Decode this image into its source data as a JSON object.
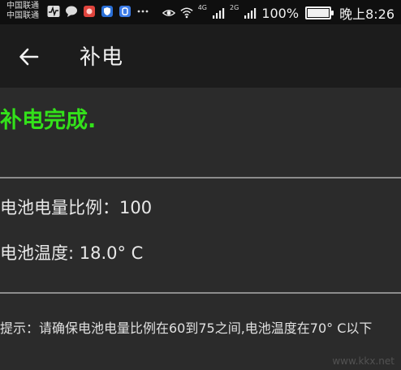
{
  "status_bar": {
    "carrier_1": "中国联通",
    "carrier_2": "中国联通",
    "signal_1_label": "4G",
    "signal_2_label": "2G",
    "battery_percent_text": "100%",
    "battery_level": 1.0,
    "time": "晚上8:26",
    "notification_icons": [
      "pulse-icon",
      "chat-icon",
      "app-icon",
      "shield-icon",
      "vpn-icon",
      "more-icon"
    ],
    "system_icons": [
      "eye-icon",
      "wifi-icon",
      "signal-icon",
      "signal-icon",
      "battery-icon"
    ]
  },
  "app_bar": {
    "back_icon": "arrow-left-icon",
    "title": "补电"
  },
  "main": {
    "completion_text": "补电完成.",
    "battery_ratio_line": "电池电量比例：100",
    "battery_temp_line": "电池温度: 18.0° C",
    "hint_text": "提示：请确保电池电量比例在60到75之间,电池温度在70° C以下"
  },
  "colors": {
    "accent_green": "#33e11a",
    "background": "#2b2b2b",
    "app_bar": "#1c1c1c",
    "status_bar": "#0f0f0f"
  },
  "watermark": "www.kkx.net"
}
